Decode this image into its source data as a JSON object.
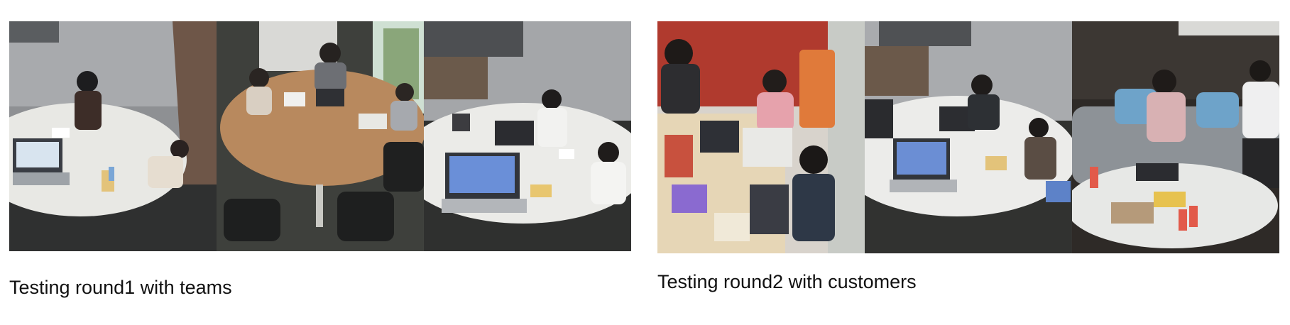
{
  "panels": [
    {
      "caption": "Testing round1 with teams",
      "photos": [
        "meeting-room-camera-view",
        "meeting-room-camera-view",
        "meeting-room-camera-view"
      ]
    },
    {
      "caption": "Testing round2 with customers",
      "photos": [
        "meeting-room-camera-view",
        "meeting-room-camera-view",
        "lounge-camera-view"
      ]
    }
  ],
  "colors": {
    "wall_grey": "#9a9c9f",
    "table_white": "#e9e9e6",
    "table_wood": "#b8895e",
    "floor_dark": "#3b3c3a",
    "red_wall": "#b03a2e",
    "sofa_grey": "#8d9297",
    "laptop_screen": "#6a8fd8"
  }
}
